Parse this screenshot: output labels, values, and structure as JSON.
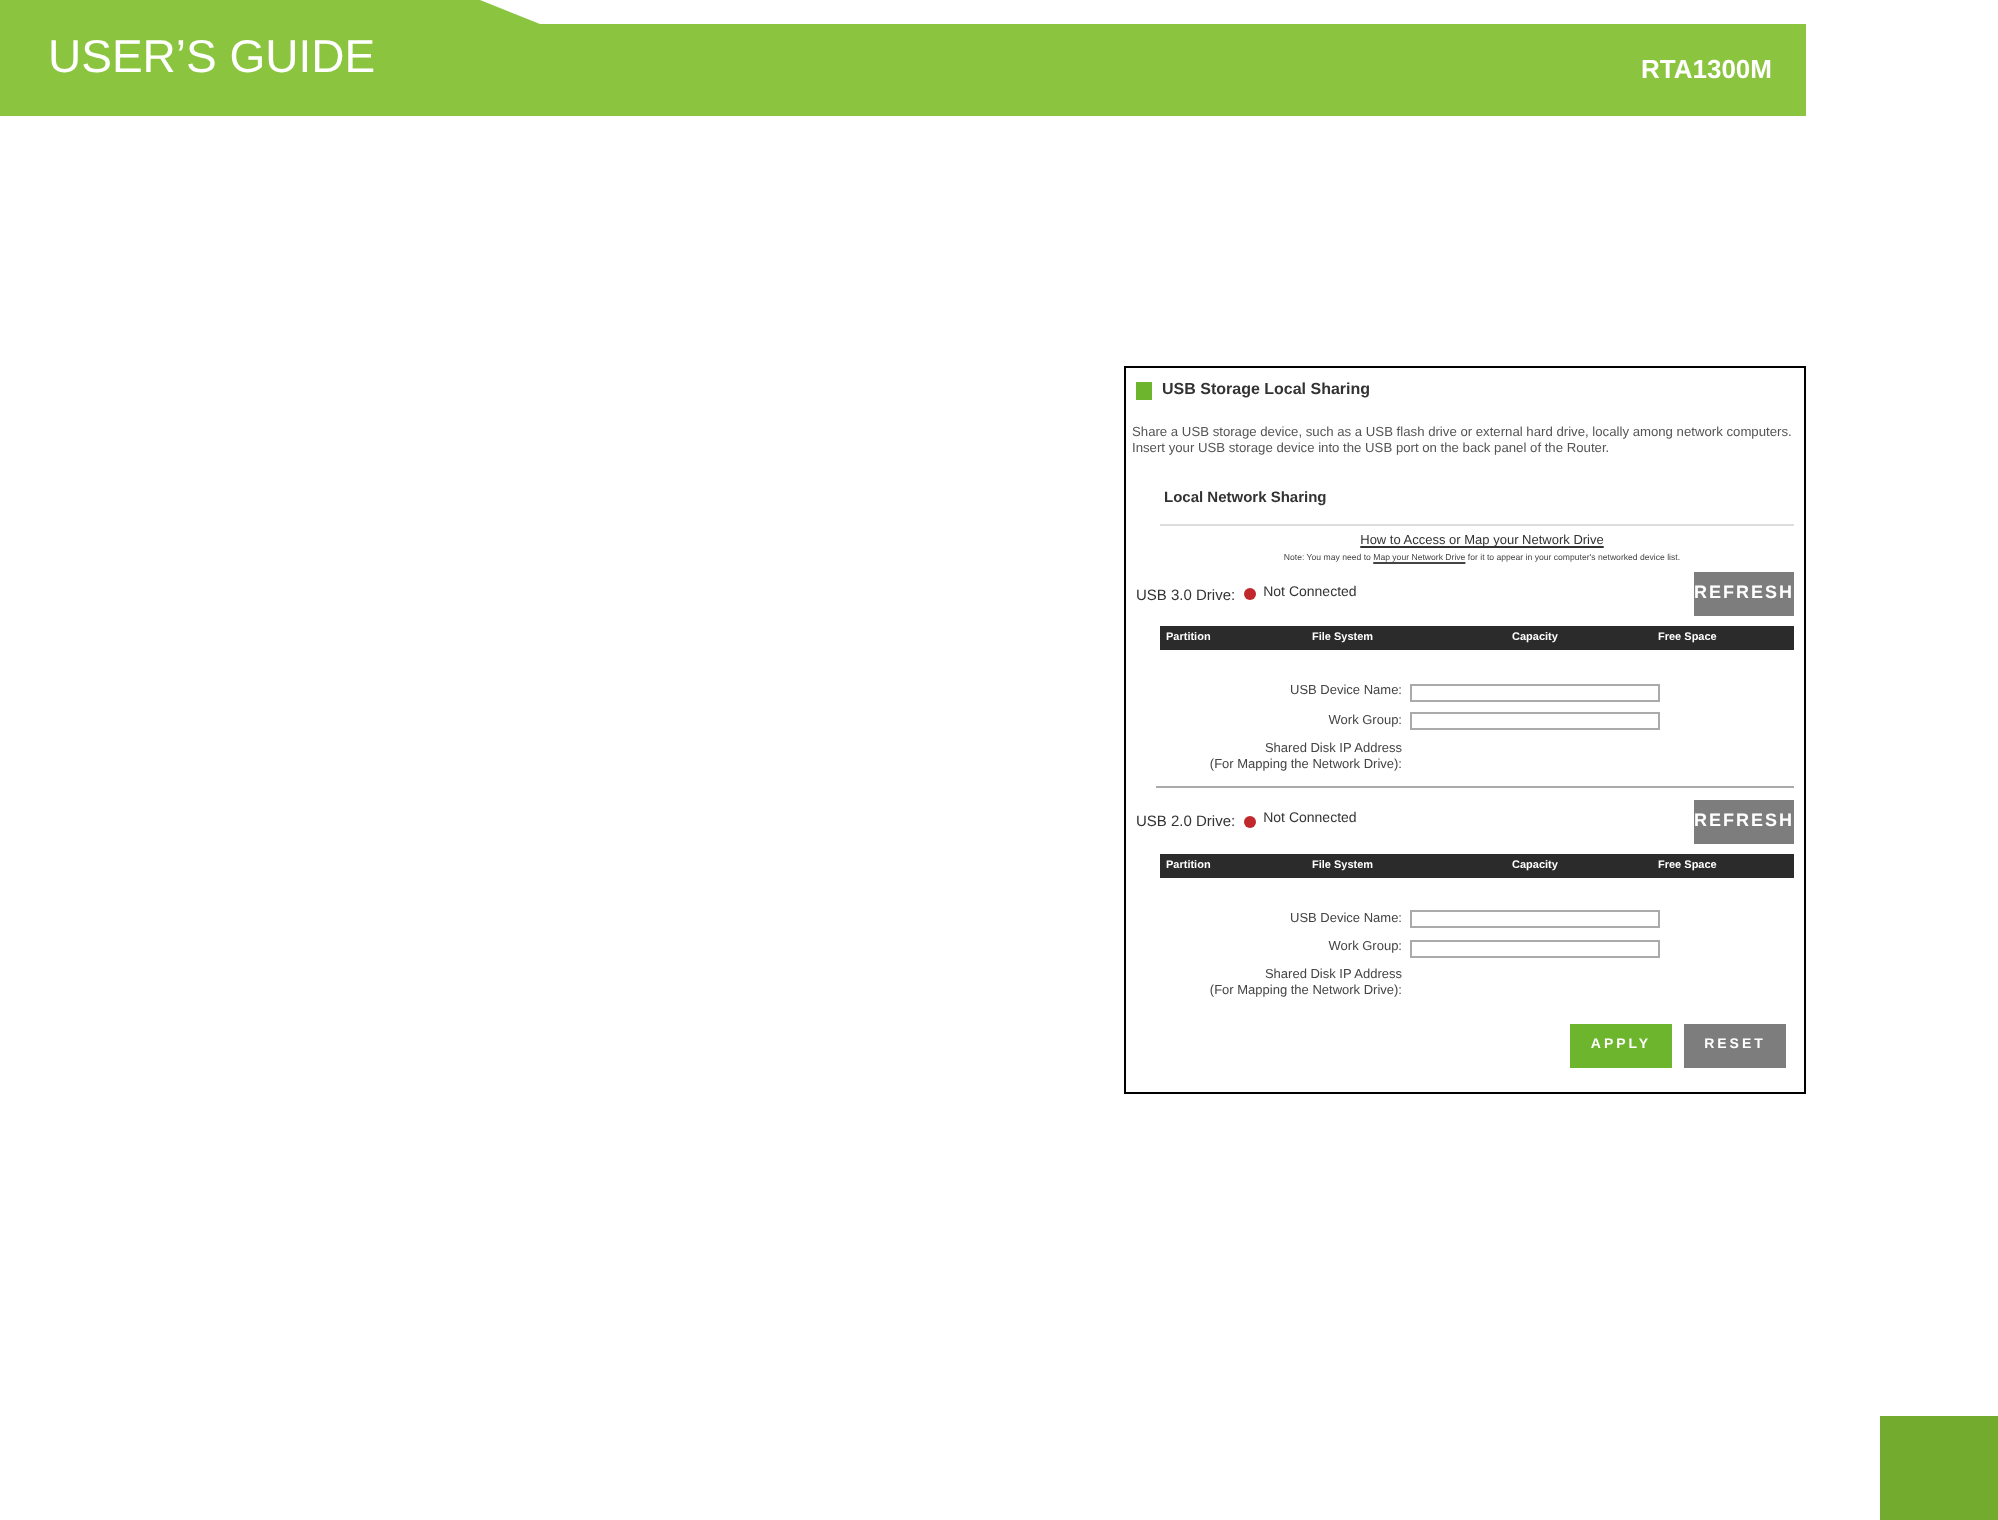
{
  "header": {
    "title": "USER’S GUIDE",
    "model": "RTA1300M"
  },
  "panel": {
    "title": "USB Storage Local Sharing",
    "description": "Share a USB storage device, such as a USB flash drive or external hard drive, locally among network computers. Insert your USB storage device into the USB port on the back panel of the Router.",
    "section_title": "Local Network Sharing",
    "help_link": "How to Access or Map your Network Drive",
    "note_before": "Note: You may need to",
    "note_link": "Map your Network Drive",
    "note_after": "for it to appear in your computer's networked device list.",
    "drives": [
      {
        "label": "USB 3.0 Drive:",
        "connected": false,
        "status": "Not Connected",
        "refresh": "REFRESH",
        "columns": [
          "Partition",
          "File System",
          "Capacity",
          "Free Space"
        ],
        "fields": [
          {
            "label": "USB Device Name:"
          },
          {
            "label": "Work Group:"
          }
        ],
        "ip_label_1": "Shared Disk IP Address",
        "ip_label_2": "(For Mapping the Network Drive):"
      },
      {
        "label": "USB 2.0 Drive:",
        "connected": false,
        "status": "Not Connected",
        "refresh": "REFRESH",
        "columns": [
          "Partition",
          "File System",
          "Capacity",
          "Free Space"
        ],
        "fields": [
          {
            "label": "USB Device Name:"
          },
          {
            "label": "Work Group:"
          }
        ],
        "ip_label_1": "Shared Disk IP Address",
        "ip_label_2": "(For Mapping the Network Drive):"
      }
    ],
    "buttons": [
      {
        "label": "APPLY",
        "kind": "primary"
      },
      {
        "label": "RESET",
        "kind": "secondary"
      }
    ]
  }
}
